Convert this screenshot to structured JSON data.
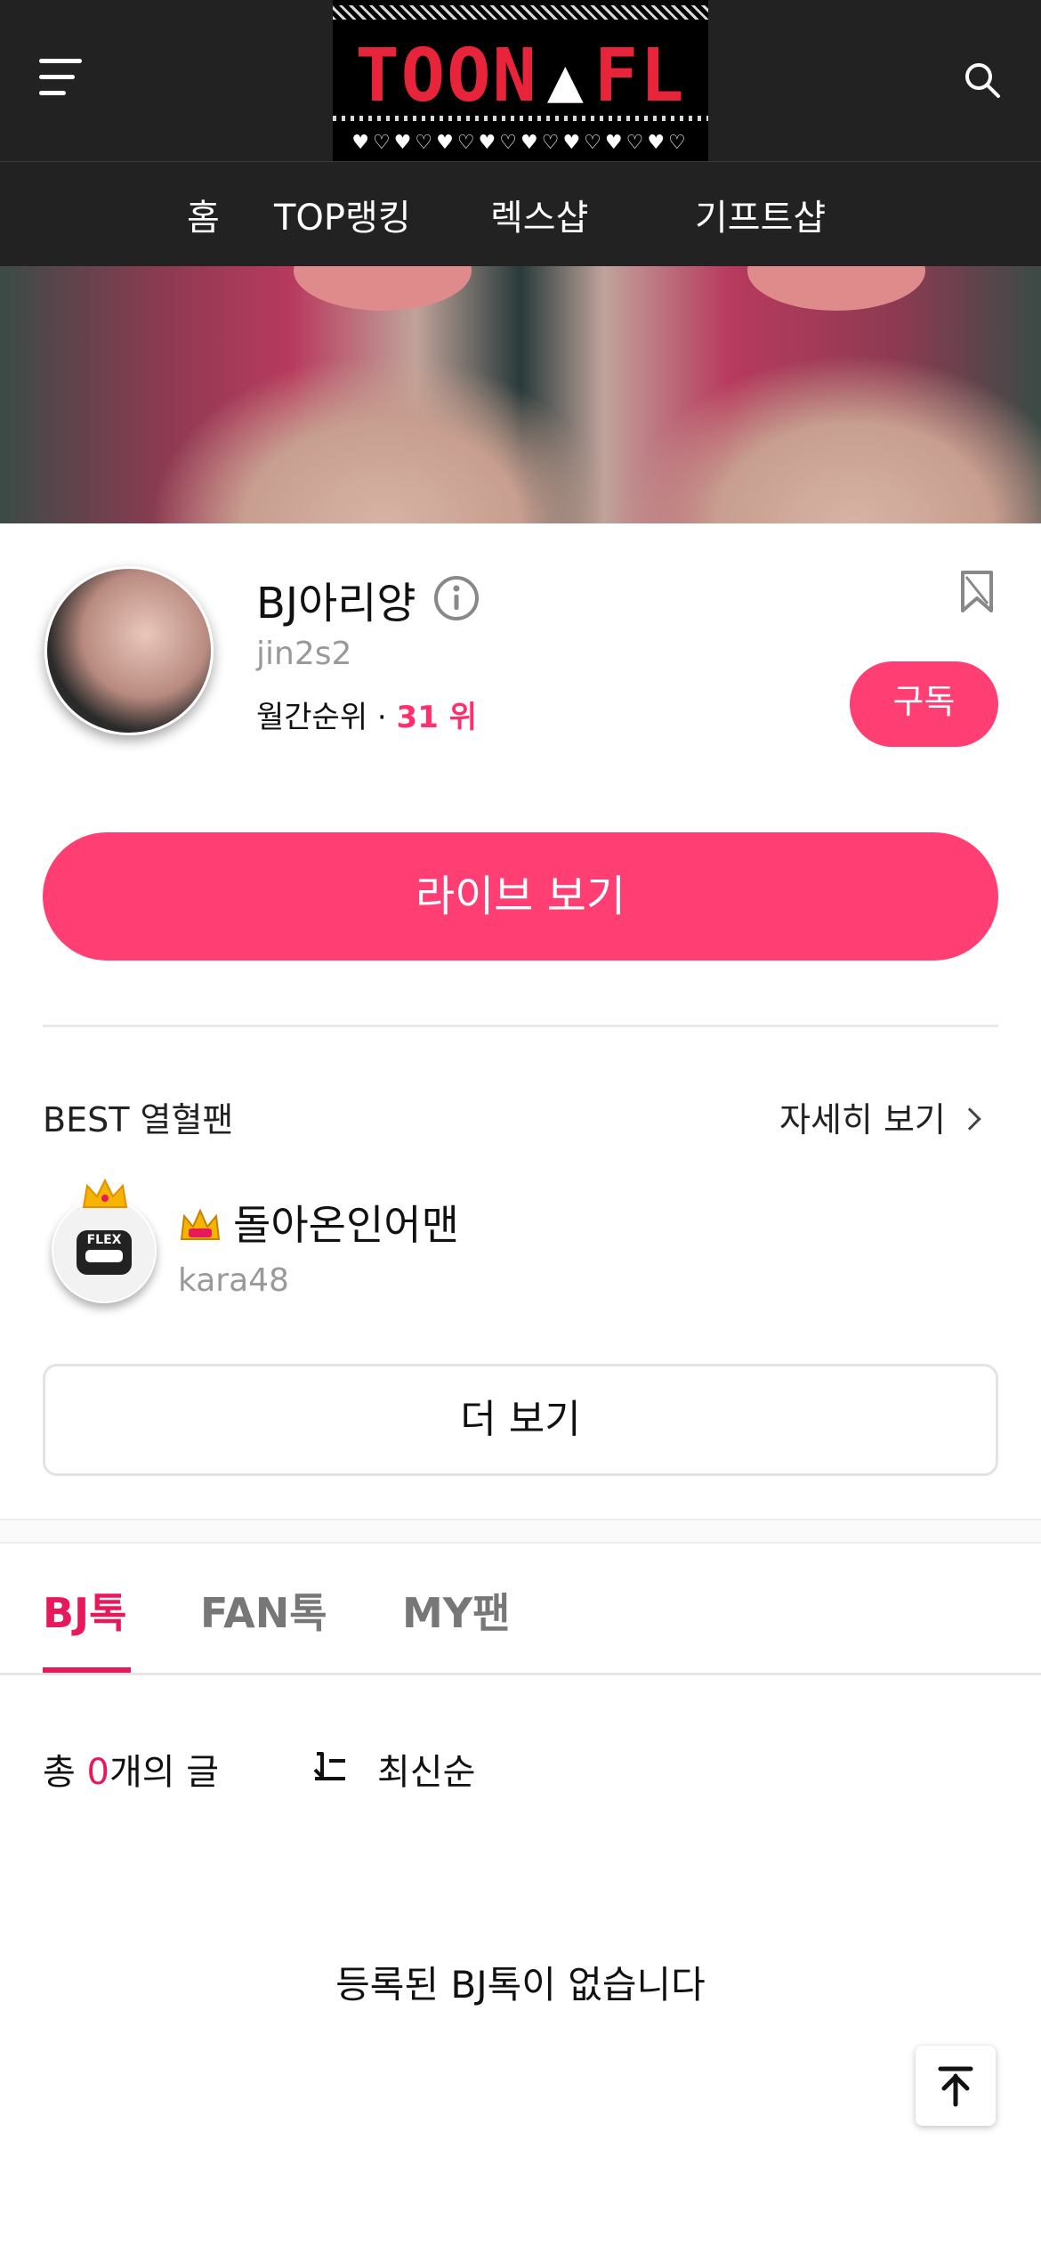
{
  "header": {
    "menu_icon": "hamburger-menu-icon",
    "search_icon": "search-icon",
    "logo_text_left": "TOON",
    "logo_text_right": "FL",
    "logo_hearts": "♥♡♥♡♥♡♥♡♥♡♥♡♥♡♥♡"
  },
  "nav": {
    "items": [
      {
        "label": "홈"
      },
      {
        "label": "TOP랭킹"
      },
      {
        "label": "렉스샵"
      },
      {
        "label": "기프트샵"
      }
    ]
  },
  "profile": {
    "name": "BJ아리양",
    "user_id": "jin2s2",
    "rank_label": "월간순위 · ",
    "rank_value": "31 위",
    "subscribe_label": "구독",
    "live_button_label": "라이브 보기"
  },
  "best_fans": {
    "title": "BEST 열혈팬",
    "detail_label": "자세히 보기",
    "fans": [
      {
        "name": "돌아온인어맨",
        "user_id": "kara48",
        "badge_text": "FLEX"
      }
    ],
    "more_label": "더 보기"
  },
  "tabs": {
    "items": [
      {
        "label": "BJ톡"
      },
      {
        "label": "FAN톡"
      },
      {
        "label": "MY팬"
      }
    ]
  },
  "posts": {
    "count_prefix": "총 ",
    "count": "0",
    "count_suffix": "개의 글",
    "sort_label": "최신순",
    "empty_message": "등록된 BJ톡이 없습니다"
  },
  "colors": {
    "accent": "#ff3f73",
    "accent_text": "#e8195a",
    "header_bg": "#222222"
  }
}
